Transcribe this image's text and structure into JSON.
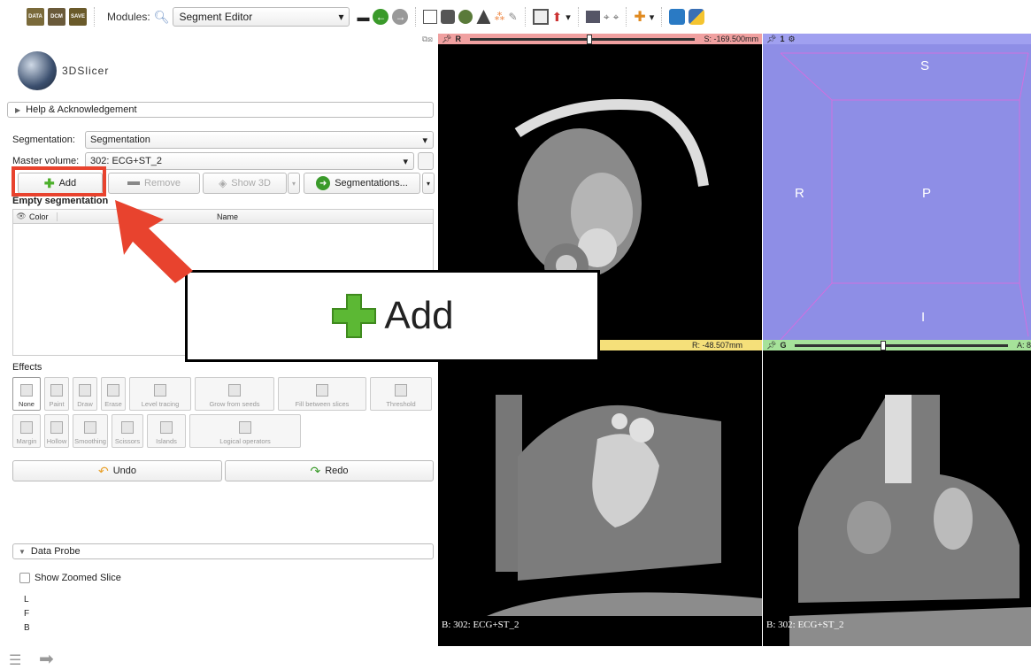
{
  "toolbar": {
    "icons": [
      "DATA",
      "DCM",
      "SAVE"
    ],
    "modules_label": "Modules:",
    "module_value": "Segment Editor"
  },
  "panel": {
    "logo_text": "3DSlicer",
    "help": "Help & Acknowledgement",
    "segmentation_label": "Segmentation:",
    "segmentation_value": "Segmentation",
    "master_label": "Master volume:",
    "master_value": "302: ECG+ST_2",
    "add": "Add",
    "remove": "Remove",
    "show3d": "Show 3D",
    "segmentations": "Segmentations...",
    "empty": "Empty segmentation",
    "col_color": "Color",
    "col_name": "Name",
    "effects": "Effects",
    "effect_row1": [
      "None",
      "Paint",
      "Draw",
      "Erase",
      "Level tracing",
      "Grow from seeds",
      "Fill between slices",
      "Threshold"
    ],
    "effect_row2": [
      "Margin",
      "Hollow",
      "Smoothing",
      "Scissors",
      "Islands",
      "Logical operators"
    ],
    "undo": "Undo",
    "redo": "Redo",
    "data_probe": "Data Probe",
    "show_zoomed": "Show Zoomed Slice",
    "probe_lines": [
      "L",
      "F",
      "B"
    ]
  },
  "views": {
    "red_label": "R",
    "red_offset": "S: -169.500mm",
    "three_d_label": "1",
    "yellow_offset": "R: -48.507mm",
    "green_label": "G",
    "green_offset": "A: 8",
    "orient_s": "S",
    "orient_r": "R",
    "orient_p": "P",
    "orient_i": "I",
    "bottom_label_1": "B: 302: ECG+ST_2",
    "bottom_label_2": "B: 302: ECG+ST_2"
  },
  "zoom_callout": "Add",
  "colors": {
    "highlight": "#e8432e",
    "add_green": "#4caf2a",
    "red_bar": "#f0a0a0",
    "yellow_bar": "#f5e07a",
    "green_bar": "#a6e29a",
    "three_d_bg": "#8e8ee6"
  }
}
